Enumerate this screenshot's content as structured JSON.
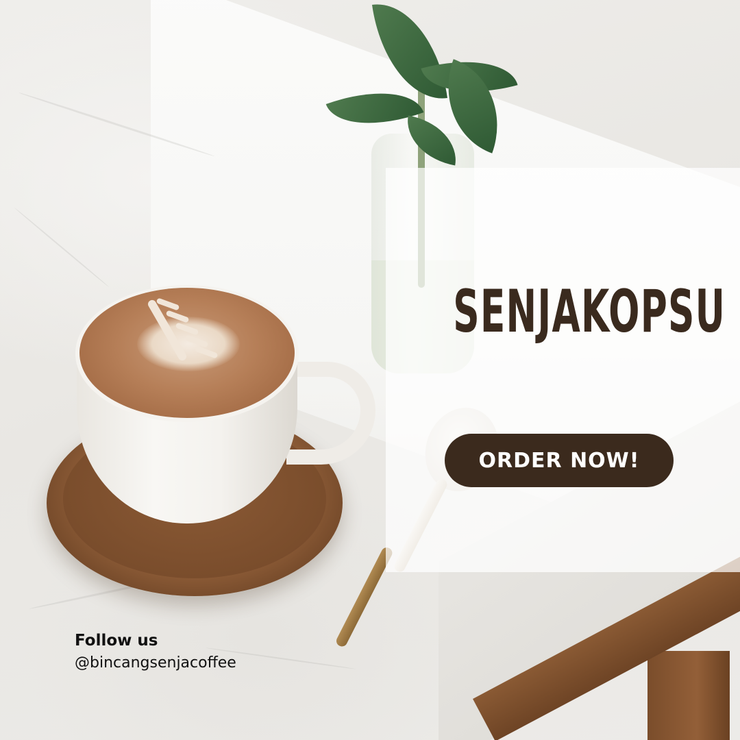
{
  "poster": {
    "brand_name": "SENJAKOPSU",
    "cta_label": "ORDER NOW!",
    "follow_label": "Follow us",
    "social_handle": "@bincangsenjacoffee"
  },
  "colors": {
    "brand_dark_brown": "#3b2a1d",
    "title_brown": "#3a2a1e",
    "button_text": "#ffffff",
    "panel_overlay": "#ffffff"
  }
}
